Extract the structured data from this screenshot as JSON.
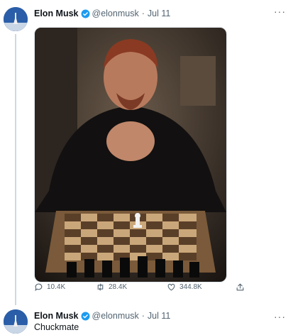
{
  "tweets": [
    {
      "author_name": "Elon Musk",
      "verified": true,
      "handle": "@elonmusk",
      "separator": "·",
      "date": "Jul 11",
      "more_icon": "more-dots-icon",
      "more_label": "···",
      "media": "photo of man with clasped hands behind a chessboard",
      "actions": {
        "reply_count": "10.4K",
        "retweet_count": "28.4K",
        "like_count": "344.8K"
      }
    },
    {
      "author_name": "Elon Musk",
      "verified": true,
      "handle": "@elonmusk",
      "separator": "·",
      "date": "Jul 11",
      "more_label": "···",
      "text": "Chuckmate"
    }
  ],
  "colors": {
    "verified_blue": "#1d9bf0",
    "secondary_text": "#536471",
    "thread_line": "#cfd9de"
  },
  "icons": [
    "verified-icon",
    "reply-icon",
    "retweet-icon",
    "like-icon",
    "share-icon",
    "more-dots-icon"
  ]
}
